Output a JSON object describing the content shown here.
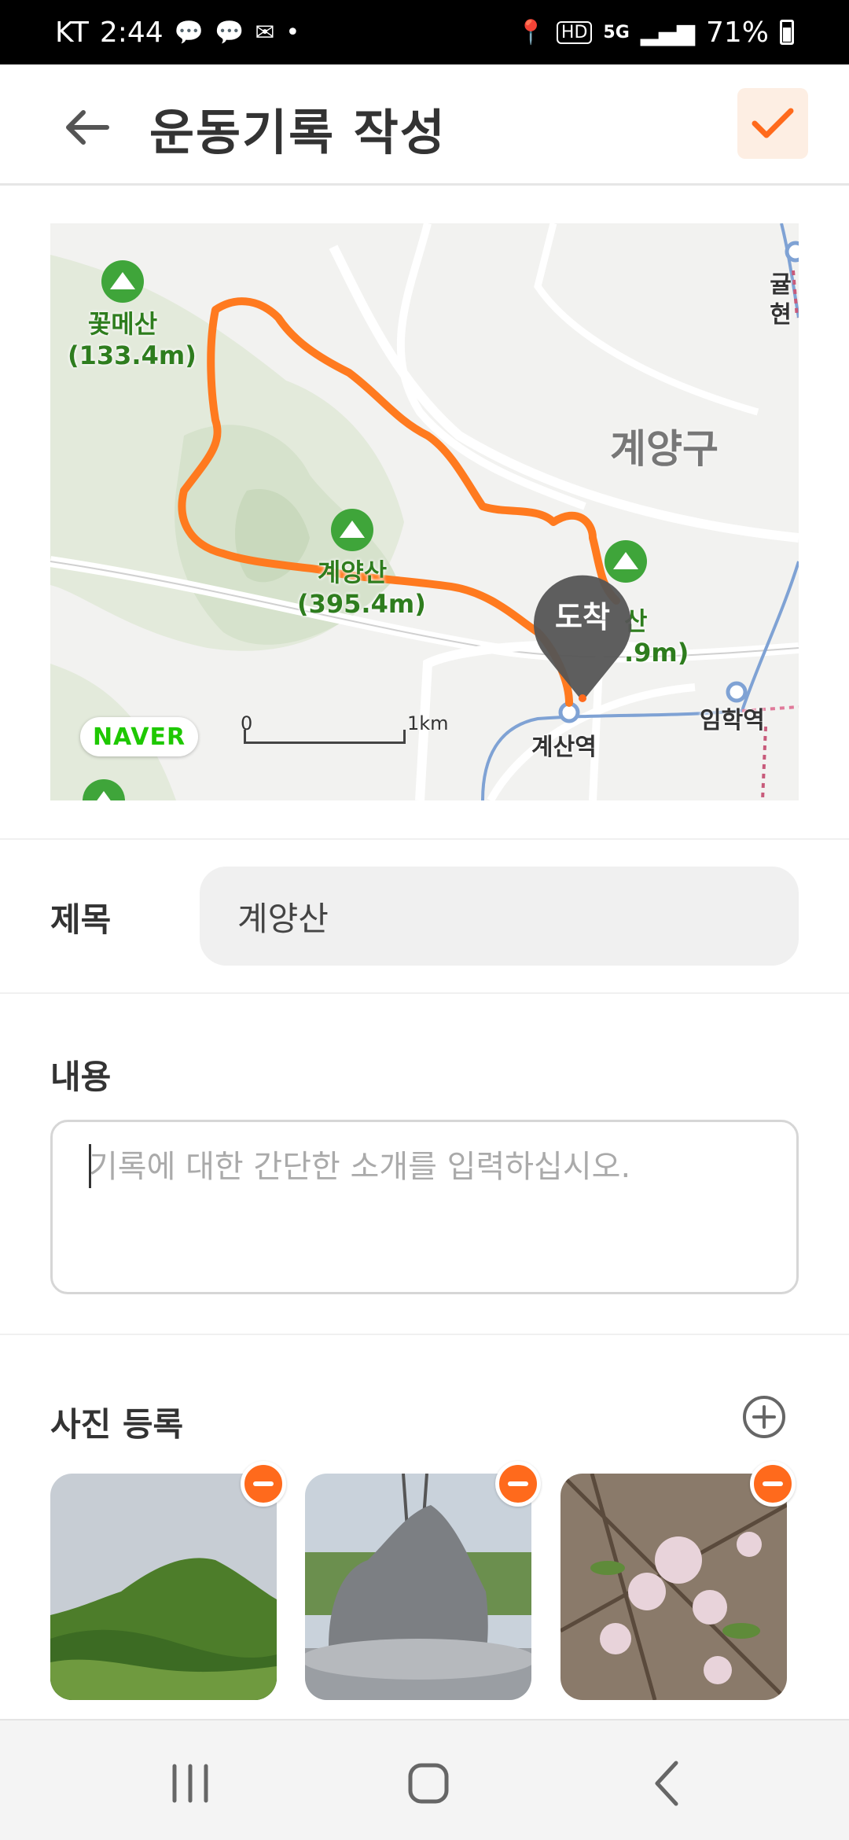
{
  "status_bar": {
    "carrier": "KT",
    "time": "2:44",
    "network": "5G",
    "hd": "HD",
    "battery": "71%"
  },
  "header": {
    "title": "운동기록 작성",
    "accent_color": "#ff6a1c"
  },
  "map": {
    "peaks": [
      {
        "name": "꽃메산",
        "height": "(133.4m)"
      },
      {
        "name": "계양산",
        "height": "(395.4m)"
      },
      {
        "name": "산",
        "height": ".9m)"
      }
    ],
    "district": "계양구",
    "stations": [
      "계산역",
      "임학역",
      "귤현"
    ],
    "marker_label": "도착",
    "logo": "NAVER",
    "scale_start": "0",
    "scale_end": "1km",
    "route_color": "#ff7a1f"
  },
  "form": {
    "title_label": "제목",
    "title_value": "계양산",
    "content_label": "내용",
    "content_placeholder": "기록에 대한 간단한 소개를 입력하십시오.",
    "photo_label": "사진 등록"
  },
  "icons": {
    "back": "arrow-left-icon",
    "confirm": "check-icon",
    "add_photo": "plus-circle-icon",
    "remove_photo": "minus-circle-icon"
  }
}
